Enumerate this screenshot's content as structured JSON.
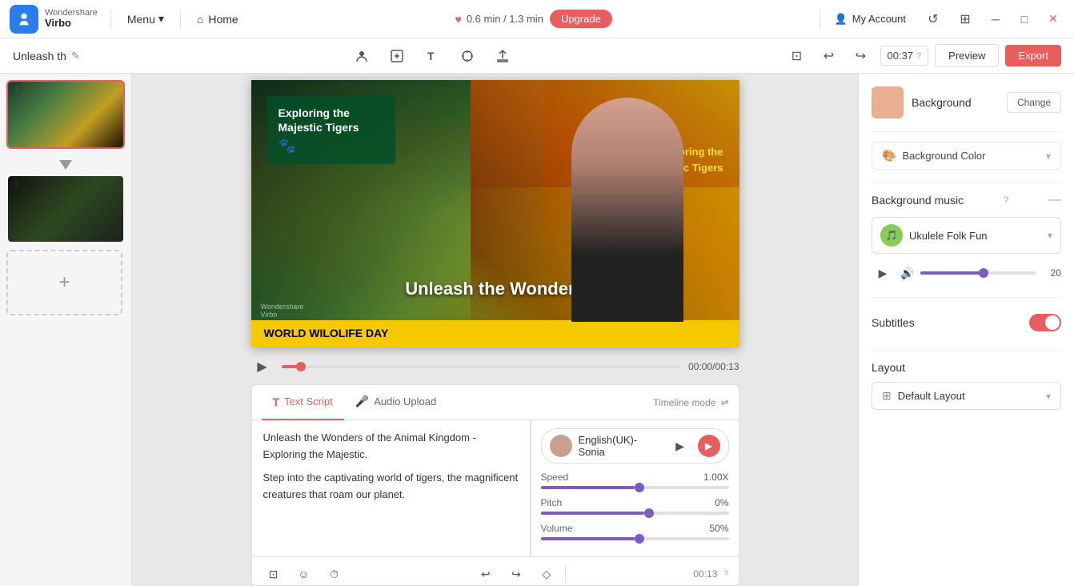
{
  "app": {
    "brand": "Wondershare",
    "product": "Virbo"
  },
  "topbar": {
    "menu_label": "Menu",
    "home_label": "Home",
    "timer": "0.6 min / 1.3 min",
    "upgrade_label": "Upgrade",
    "account_label": "My Account"
  },
  "toolbar": {
    "project_title": "Unleash th",
    "time_display": "00:37",
    "preview_label": "Preview",
    "export_label": "Export"
  },
  "canvas": {
    "overlay_title": "Exploring the Majestic Tigers",
    "main_title": "Unleash the Wonders",
    "subtitle": "Exploring the\nMajestic Tigers",
    "bottom_text": "WORLD WILOLIFE DAY",
    "watermark": "Wondershare\nVirbo",
    "playback_time": "00:00/00:13"
  },
  "script": {
    "tab_text_label": "Text Script",
    "tab_audio_label": "Audio Upload",
    "timeline_mode_label": "Timeline mode",
    "text_line1": "Unleash the Wonders of the Animal Kingdom - Exploring the Majestic.",
    "text_line2": "Step into the captivating world of tigers, the magnificent creatures that roam our planet.",
    "script_time": "00:13"
  },
  "voice": {
    "language": "English(UK)-Sonia",
    "speed_label": "Speed",
    "speed_value": "1.00X",
    "pitch_label": "Pitch",
    "pitch_value": "0%",
    "volume_label": "Volume",
    "volume_value": "50%"
  },
  "settings": {
    "background_label": "Background",
    "change_label": "Change",
    "bg_color_label": "Background Color",
    "bg_music_label": "Background music",
    "music_name": "Ukulele Folk Fun",
    "volume_num": "20",
    "subtitles_label": "Subtitles",
    "layout_label": "Layout",
    "default_layout_label": "Default Layout"
  }
}
